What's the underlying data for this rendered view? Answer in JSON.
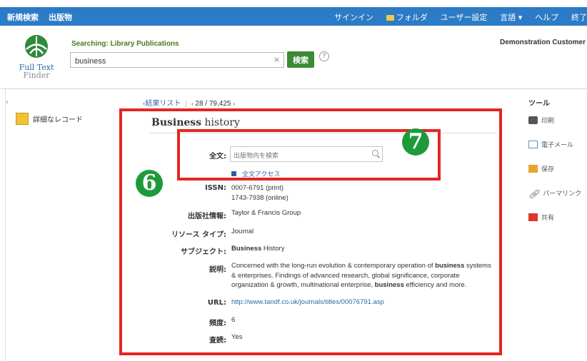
{
  "topnav": {
    "left": [
      "新規検索",
      "出版物"
    ],
    "signin": "サインイン",
    "folder": "フォルダ",
    "user_settings": "ユーザー設定",
    "language": "言語 ▾",
    "help": "ヘルプ",
    "exit": "終了"
  },
  "logo": {
    "line1": "Full Text",
    "line2": "Finder"
  },
  "search": {
    "label": "Searching: Library Publications",
    "value": "business",
    "clear": "×",
    "button": "検索",
    "help": "?"
  },
  "customer": "Demonstration Customer",
  "left": {
    "tick": "‹",
    "detail_label": "詳細なレコード"
  },
  "pager": {
    "back": "‹結果リスト",
    "sep": "|",
    "prev": "‹",
    "position": "28 / 79,425",
    "next": "›"
  },
  "record": {
    "title_bold": "Business",
    "title_rest": " history",
    "fulltext_label": "全文:",
    "fulltext_placeholder": "出版物内を検索",
    "fulltext_access": "全文アクセス",
    "issn_label": "ISSN:",
    "issn_print": "0007-6791 (print)",
    "issn_online": "1743-7938 (online)",
    "publisher_label": "出版社情報:",
    "publisher": "Taylor & Francis Group",
    "resource_label": "リソース タイプ:",
    "resource": "Journal",
    "subject_label": "サブジェクト:",
    "subject_bold": "Business",
    "subject_rest": " History",
    "desc_label": "説明:",
    "desc_1": "Concerned with the long-run evolution & contemporary operation of ",
    "desc_b1": "business",
    "desc_2": " systems & enterprises. Findings of advanced research, global significance, corporate organization & growth, multinational enterprise, ",
    "desc_b2": "business",
    "desc_3": " efficiency and more.",
    "url_label": "URL:",
    "url": "http://www.tandf.co.uk/journals/titles/00076791.asp",
    "freq_label": "頻度:",
    "freq": "6",
    "peer_label": "査読:",
    "peer": "Yes"
  },
  "tools": {
    "title": "ツール",
    "print": "印刷",
    "email": "電子メール",
    "save": "保存",
    "permalink": "パーマリンク",
    "share": "共有"
  },
  "badges": {
    "six": "6",
    "seven": "7"
  },
  "colors": {
    "topbar": "#2c7bc6",
    "search_button": "#3b8a34",
    "highlight": "#e32621",
    "badge": "#1f9a3a"
  }
}
